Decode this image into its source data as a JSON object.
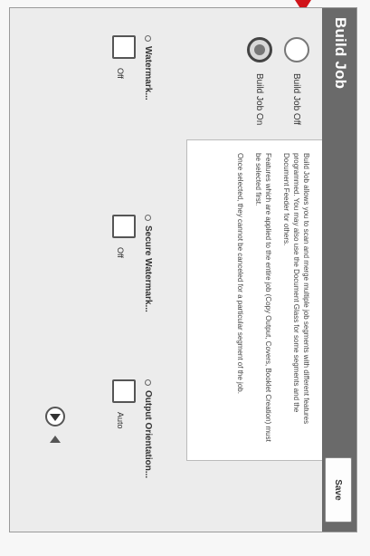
{
  "window": {
    "title": "Build Job",
    "save_label": "Save"
  },
  "mode": {
    "options": [
      {
        "label": "Build Job Off",
        "selected": false
      },
      {
        "label": "Build Job On",
        "selected": true
      }
    ]
  },
  "info": {
    "paragraphs": [
      "Build Job allows you to scan and merge multiple job segments with different features programmed. You may also use the Document Glass for some segments and the Document Feeder for others.",
      "Features which are applied to the entire job (Copy Output, Covers, Booklet Creation) must be selected first.",
      "Once selected, they cannot be canceled for a particular segment of the job."
    ]
  },
  "features": [
    {
      "title": "Watermark...",
      "value": "Off"
    },
    {
      "title": "Secure Watermark...",
      "value": "Off"
    },
    {
      "title": "Output Orientation...",
      "value": "Auto"
    }
  ],
  "colors": {
    "titlebar": "#6a6a6a",
    "annotation_arrow": "#d0141a"
  },
  "icons": {
    "pager_next": "triangle-right-icon",
    "pager_prev": "triangle-left-icon"
  }
}
